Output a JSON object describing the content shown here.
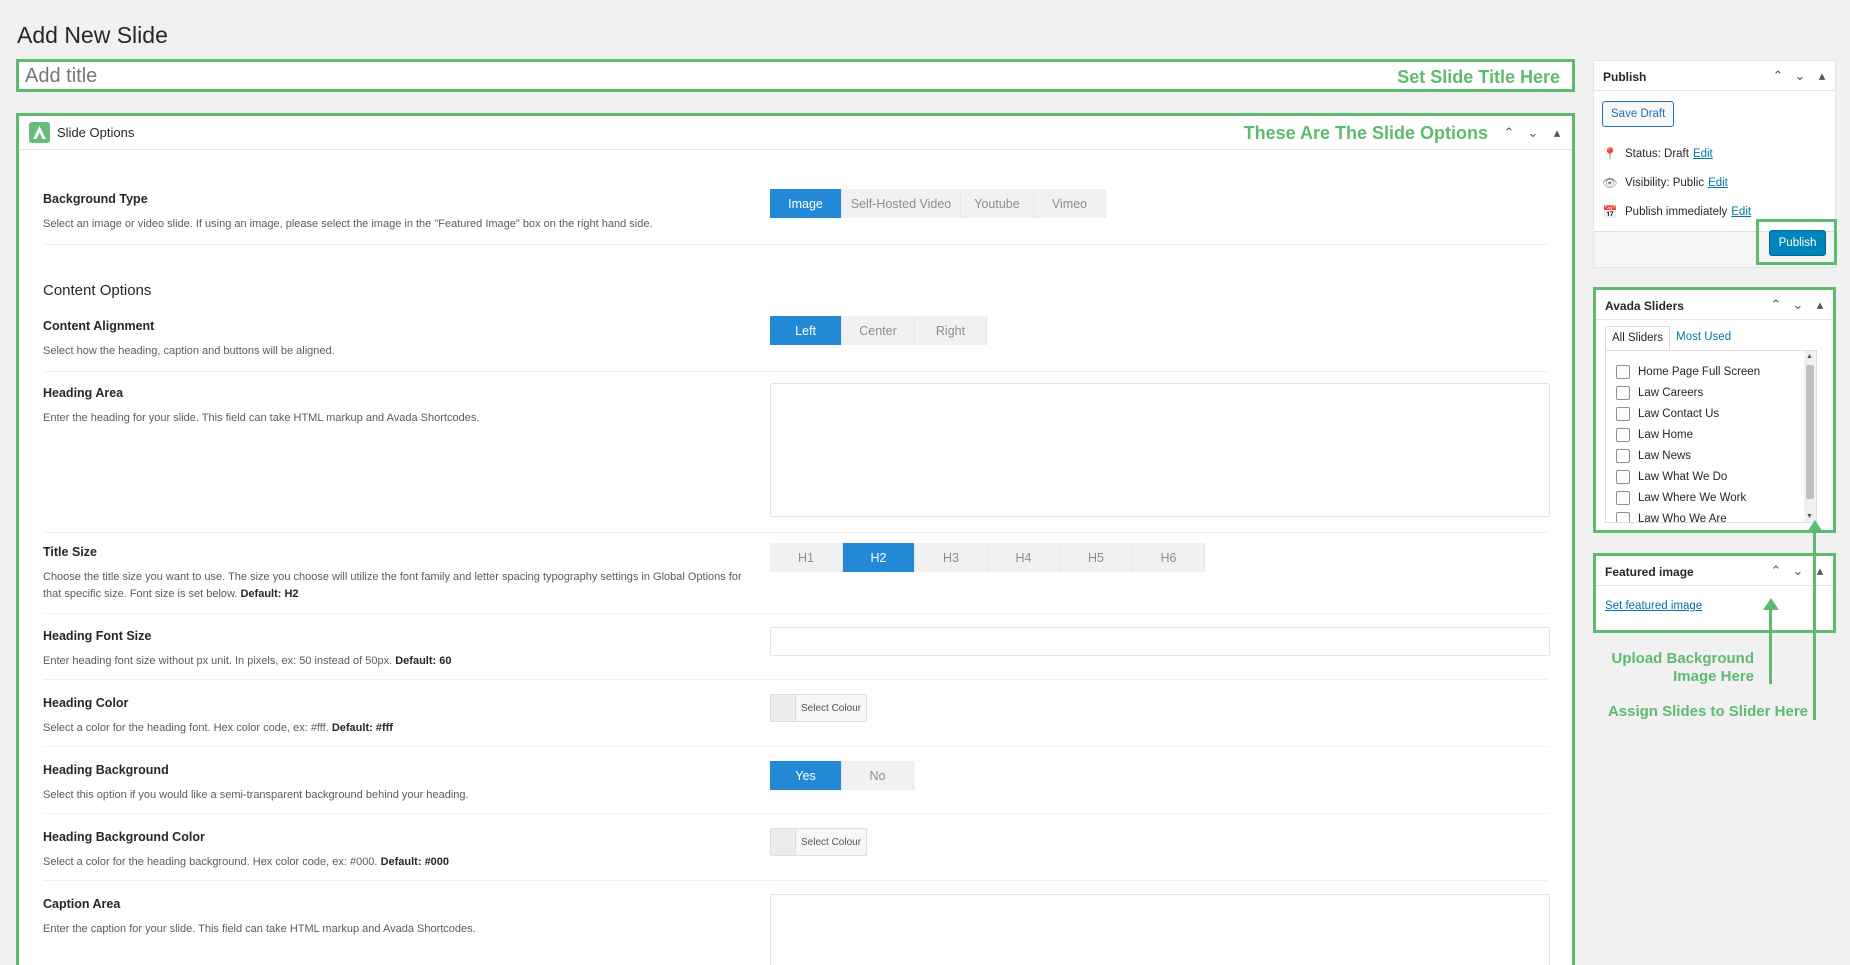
{
  "page": {
    "title": "Add New Slide"
  },
  "title_field": {
    "placeholder": "Add title",
    "note": "Set Slide Title Here"
  },
  "options": {
    "heading": "Slide Options",
    "note": "These Are The Slide Options",
    "background_type": {
      "label": "Background Type",
      "desc": "Select an image or video slide. If using an image, please select the image in the \"Featured Image\" box on the right hand side.",
      "buttons": [
        "Image",
        "Self-Hosted Video",
        "Youtube",
        "Vimeo"
      ],
      "selected": "Image"
    },
    "content_options_title": "Content Options",
    "content_alignment": {
      "label": "Content Alignment",
      "desc": "Select how the heading, caption and buttons will be aligned.",
      "buttons": [
        "Left",
        "Center",
        "Right"
      ],
      "selected": "Left"
    },
    "heading_area": {
      "label": "Heading Area",
      "desc": "Enter the heading for your slide. This field can take HTML markup and Avada Shortcodes."
    },
    "title_size": {
      "label": "Title Size",
      "desc": "Choose the title size you want to use. The size you choose will utilize the font family and letter spacing typography settings in Global Options for that specific size. Font size is set below.",
      "default": "Default: H2",
      "buttons": [
        "H1",
        "H2",
        "H3",
        "H4",
        "H5",
        "H6"
      ],
      "selected": "H2"
    },
    "heading_font_size": {
      "label": "Heading Font Size",
      "desc": "Enter heading font size without px unit. In pixels, ex: 50 instead of 50px.",
      "default": "Default: 60"
    },
    "heading_color": {
      "label": "Heading Color",
      "desc": "Select a color for the heading font. Hex color code, ex: #fff.",
      "default": "Default: #fff",
      "button": "Select Colour"
    },
    "heading_background": {
      "label": "Heading Background",
      "desc": "Select this option if you would like a semi-transparent background behind your heading.",
      "buttons": [
        "Yes",
        "No"
      ],
      "selected": "Yes"
    },
    "heading_bg_color": {
      "label": "Heading Background Color",
      "desc": "Select a color for the heading background. Hex color code, ex: #000.",
      "default": "Default: #000",
      "button": "Select Colour"
    },
    "caption_area": {
      "label": "Caption Area",
      "desc": "Enter the caption for your slide. This field can take HTML markup and Avada Shortcodes."
    }
  },
  "publish": {
    "title": "Publish",
    "save_draft": "Save Draft",
    "status_label": "Status:",
    "status_value": "Draft",
    "visibility_label": "Visibility:",
    "visibility_value": "Public",
    "publish_when": "Publish immediately",
    "edit": "Edit",
    "publish_button": "Publish"
  },
  "sliders": {
    "title": "Avada Sliders",
    "tabs": [
      "All Sliders",
      "Most Used"
    ],
    "items": [
      "Home Page Full Screen",
      "Law Careers",
      "Law Contact Us",
      "Law Home",
      "Law News",
      "Law What We Do",
      "Law Where We Work",
      "Law Who We Are"
    ]
  },
  "featured": {
    "title": "Featured image",
    "link": "Set featured image"
  },
  "notes": {
    "upload_bg": "Upload Background Image Here",
    "assign": "Assign Slides to Slider Here"
  },
  "colors": {
    "accent_green": "#5dbb6f",
    "primary_blue": "#2389d7",
    "link_blue": "#0073aa"
  }
}
